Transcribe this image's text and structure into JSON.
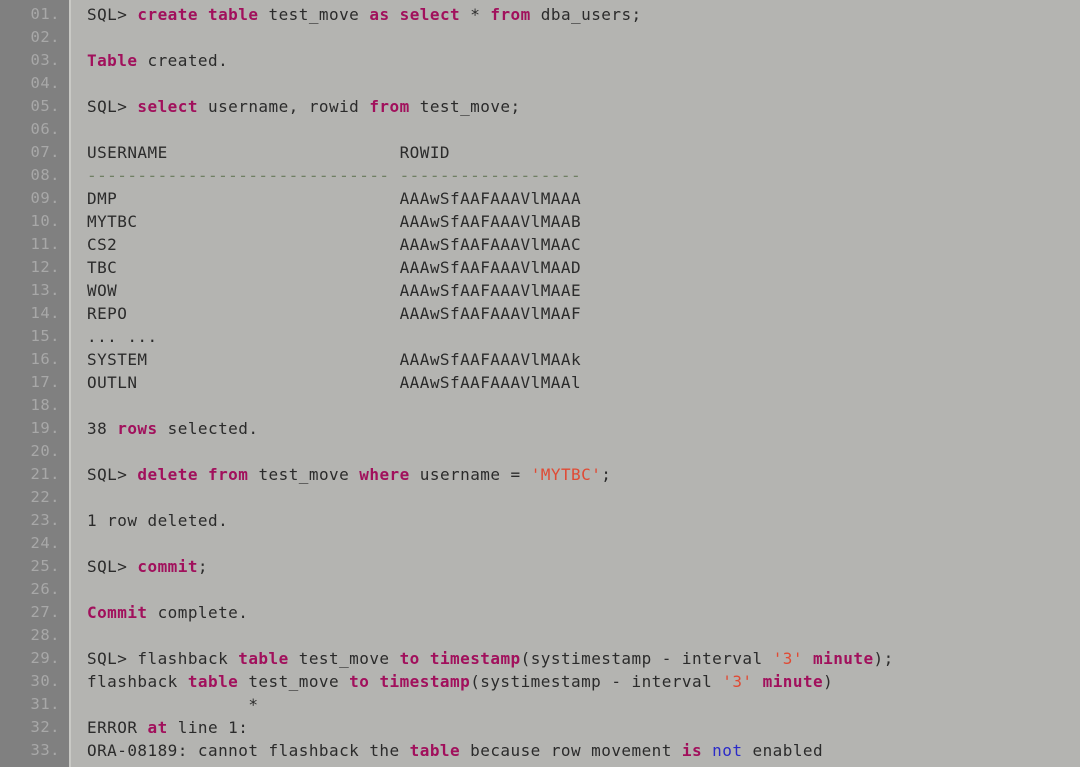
{
  "colors": {
    "gutter_bg": "#808080",
    "code_bg": "#b4b4b1",
    "page_bg": "#aeaeae",
    "line_number": "#a8a8a8",
    "plain_text": "#2b2b2b",
    "keyword": "#a1105c",
    "string_literal": "#e04a34",
    "keyword_alt": "#2b2bc8",
    "separator": "#6f7f63",
    "divider": "#c9c9c5"
  },
  "gutter": {
    "line_numbers": [
      "01.",
      "02.",
      "03.",
      "04.",
      "05.",
      "06.",
      "07.",
      "08.",
      "09.",
      "10.",
      "11.",
      "12.",
      "13.",
      "14.",
      "15.",
      "16.",
      "17.",
      "18.",
      "19.",
      "20.",
      "21.",
      "22.",
      "23.",
      "24.",
      "25.",
      "26.",
      "27.",
      "28.",
      "29.",
      "30.",
      "31.",
      "32.",
      "33."
    ]
  },
  "code": {
    "language": "sql",
    "lines": [
      {
        "n": "01.",
        "text": "SQL> create table test_move as select * from dba_users;",
        "tokens": [
          {
            "t": "SQL> ",
            "c": "pl"
          },
          {
            "t": "create",
            "c": "kw"
          },
          {
            "t": " ",
            "c": "pl"
          },
          {
            "t": "table",
            "c": "kw"
          },
          {
            "t": " test_move ",
            "c": "pl"
          },
          {
            "t": "as",
            "c": "kw"
          },
          {
            "t": " ",
            "c": "pl"
          },
          {
            "t": "select",
            "c": "kw"
          },
          {
            "t": " * ",
            "c": "pl"
          },
          {
            "t": "from",
            "c": "kw"
          },
          {
            "t": " dba_users;",
            "c": "pl"
          }
        ]
      },
      {
        "n": "02.",
        "text": "",
        "tokens": []
      },
      {
        "n": "03.",
        "text": "Table created.",
        "tokens": [
          {
            "t": "Table",
            "c": "kw"
          },
          {
            "t": " created.",
            "c": "pl"
          }
        ]
      },
      {
        "n": "04.",
        "text": "",
        "tokens": []
      },
      {
        "n": "05.",
        "text": "SQL> select username, rowid from test_move;",
        "tokens": [
          {
            "t": "SQL> ",
            "c": "pl"
          },
          {
            "t": "select",
            "c": "kw"
          },
          {
            "t": " username, rowid ",
            "c": "pl"
          },
          {
            "t": "from",
            "c": "kw"
          },
          {
            "t": " test_move;",
            "c": "pl"
          }
        ]
      },
      {
        "n": "06.",
        "text": "",
        "tokens": []
      },
      {
        "n": "07.",
        "text": "USERNAME                       ROWID",
        "tokens": [
          {
            "t": "USERNAME                       ROWID",
            "c": "pl"
          }
        ]
      },
      {
        "n": "08.",
        "text": "------------------------------ ------------------",
        "tokens": [
          {
            "t": "------------------------------ ------------------",
            "c": "sep"
          }
        ]
      },
      {
        "n": "09.",
        "text": "DMP                            AAAwSfAAFAAAVlMAAA",
        "tokens": [
          {
            "t": "DMP                            AAAwSfAAFAAAVlMAAA",
            "c": "pl"
          }
        ]
      },
      {
        "n": "10.",
        "text": "MYTBC                          AAAwSfAAFAAAVlMAAB",
        "tokens": [
          {
            "t": "MYTBC                          AAAwSfAAFAAAVlMAAB",
            "c": "pl"
          }
        ]
      },
      {
        "n": "11.",
        "text": "CS2                            AAAwSfAAFAAAVlMAAC",
        "tokens": [
          {
            "t": "CS2                            AAAwSfAAFAAAVlMAAC",
            "c": "pl"
          }
        ]
      },
      {
        "n": "12.",
        "text": "TBC                            AAAwSfAAFAAAVlMAAD",
        "tokens": [
          {
            "t": "TBC                            AAAwSfAAFAAAVlMAAD",
            "c": "pl"
          }
        ]
      },
      {
        "n": "13.",
        "text": "WOW                            AAAwSfAAFAAAVlMAAE",
        "tokens": [
          {
            "t": "WOW                            AAAwSfAAFAAAVlMAAE",
            "c": "pl"
          }
        ]
      },
      {
        "n": "14.",
        "text": "REPO                           AAAwSfAAFAAAVlMAAF",
        "tokens": [
          {
            "t": "REPO                           AAAwSfAAFAAAVlMAAF",
            "c": "pl"
          }
        ]
      },
      {
        "n": "15.",
        "text": "... ...",
        "tokens": [
          {
            "t": "... ...",
            "c": "pl"
          }
        ]
      },
      {
        "n": "16.",
        "text": "SYSTEM                         AAAwSfAAFAAAVlMAAk",
        "tokens": [
          {
            "t": "SYSTEM                         AAAwSfAAFAAAVlMAAk",
            "c": "pl"
          }
        ]
      },
      {
        "n": "17.",
        "text": "OUTLN                          AAAwSfAAFAAAVlMAAl",
        "tokens": [
          {
            "t": "OUTLN                          AAAwSfAAFAAAVlMAAl",
            "c": "pl"
          }
        ]
      },
      {
        "n": "18.",
        "text": "",
        "tokens": []
      },
      {
        "n": "19.",
        "text": "38 rows selected.",
        "tokens": [
          {
            "t": "38 ",
            "c": "pl"
          },
          {
            "t": "rows",
            "c": "kw"
          },
          {
            "t": " selected.",
            "c": "pl"
          }
        ]
      },
      {
        "n": "20.",
        "text": "",
        "tokens": []
      },
      {
        "n": "21.",
        "text": "SQL> delete from test_move where username = 'MYTBC';",
        "tokens": [
          {
            "t": "SQL> ",
            "c": "pl"
          },
          {
            "t": "delete",
            "c": "kw"
          },
          {
            "t": " ",
            "c": "pl"
          },
          {
            "t": "from",
            "c": "kw"
          },
          {
            "t": " test_move ",
            "c": "pl"
          },
          {
            "t": "where",
            "c": "kw"
          },
          {
            "t": " username = ",
            "c": "pl"
          },
          {
            "t": "'MYTBC'",
            "c": "str"
          },
          {
            "t": ";",
            "c": "pl"
          }
        ]
      },
      {
        "n": "22.",
        "text": "",
        "tokens": []
      },
      {
        "n": "23.",
        "text": "1 row deleted.",
        "tokens": [
          {
            "t": "1 row deleted.",
            "c": "pl"
          }
        ]
      },
      {
        "n": "24.",
        "text": "",
        "tokens": []
      },
      {
        "n": "25.",
        "text": "SQL> commit;",
        "tokens": [
          {
            "t": "SQL> ",
            "c": "pl"
          },
          {
            "t": "commit",
            "c": "kw"
          },
          {
            "t": ";",
            "c": "pl"
          }
        ]
      },
      {
        "n": "26.",
        "text": "",
        "tokens": []
      },
      {
        "n": "27.",
        "text": "Commit complete.",
        "tokens": [
          {
            "t": "Commit",
            "c": "kw"
          },
          {
            "t": " complete.",
            "c": "pl"
          }
        ]
      },
      {
        "n": "28.",
        "text": "",
        "tokens": []
      },
      {
        "n": "29.",
        "text": "SQL> flashback table test_move to timestamp(systimestamp - interval '3' minute);",
        "tokens": [
          {
            "t": "SQL> flashback ",
            "c": "pl"
          },
          {
            "t": "table",
            "c": "kw"
          },
          {
            "t": " test_move ",
            "c": "pl"
          },
          {
            "t": "to",
            "c": "kw"
          },
          {
            "t": " ",
            "c": "pl"
          },
          {
            "t": "timestamp",
            "c": "kw"
          },
          {
            "t": "(systimestamp - interval ",
            "c": "pl"
          },
          {
            "t": "'3'",
            "c": "str"
          },
          {
            "t": " ",
            "c": "pl"
          },
          {
            "t": "minute",
            "c": "kw"
          },
          {
            "t": ");",
            "c": "pl"
          }
        ]
      },
      {
        "n": "30.",
        "text": "flashback table test_move to timestamp(systimestamp - interval '3' minute)",
        "tokens": [
          {
            "t": "flashback ",
            "c": "pl"
          },
          {
            "t": "table",
            "c": "kw"
          },
          {
            "t": " test_move ",
            "c": "pl"
          },
          {
            "t": "to",
            "c": "kw"
          },
          {
            "t": " ",
            "c": "pl"
          },
          {
            "t": "timestamp",
            "c": "kw"
          },
          {
            "t": "(systimestamp - interval ",
            "c": "pl"
          },
          {
            "t": "'3'",
            "c": "str"
          },
          {
            "t": " ",
            "c": "pl"
          },
          {
            "t": "minute",
            "c": "kw"
          },
          {
            "t": ")",
            "c": "pl"
          }
        ]
      },
      {
        "n": "31.",
        "text": "                *",
        "tokens": [
          {
            "t": "                *",
            "c": "pl"
          }
        ]
      },
      {
        "n": "32.",
        "text": "ERROR at line 1:",
        "tokens": [
          {
            "t": "ERROR ",
            "c": "pl"
          },
          {
            "t": "at",
            "c": "kw"
          },
          {
            "t": " line 1:",
            "c": "pl"
          }
        ]
      },
      {
        "n": "33.",
        "text": "ORA-08189: cannot flashback the table because row movement is not enabled",
        "tokens": [
          {
            "t": "ORA-08189: cannot flashback the ",
            "c": "pl"
          },
          {
            "t": "table",
            "c": "kw"
          },
          {
            "t": " because row movement ",
            "c": "pl"
          },
          {
            "t": "is",
            "c": "kw"
          },
          {
            "t": " ",
            "c": "pl"
          },
          {
            "t": "not",
            "c": "kw2"
          },
          {
            "t": " enabled",
            "c": "pl"
          }
        ]
      }
    ]
  }
}
